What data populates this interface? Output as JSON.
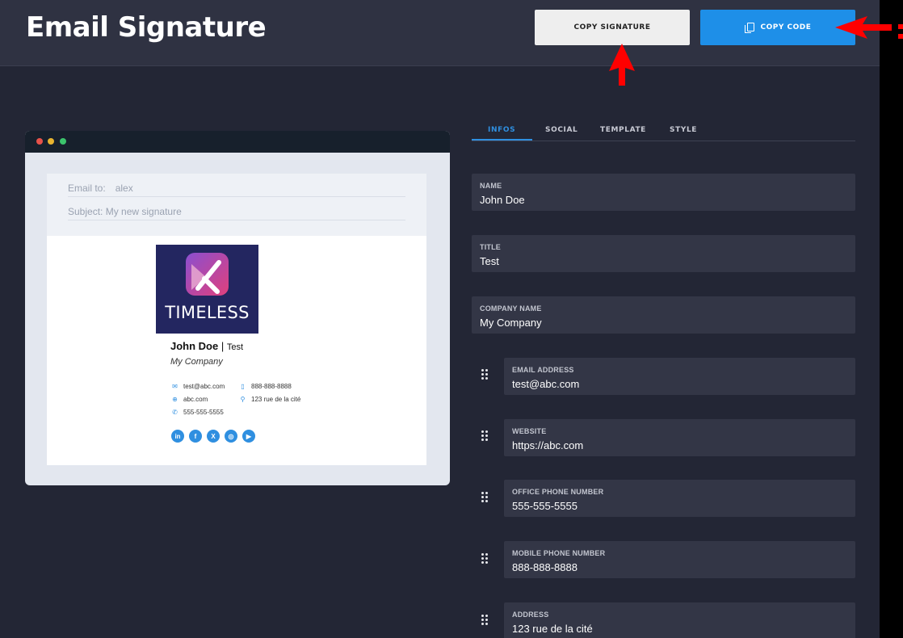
{
  "header": {
    "title": "Email Signature",
    "copy_signature_label": "COPY SIGNATURE",
    "copy_code_label": "COPY CODE"
  },
  "preview": {
    "email_to_label": "Email to:",
    "email_to_value": "alex",
    "subject_label": "Subject:",
    "subject_value": "My new signature",
    "logo_text": "TIMELESS",
    "name": "John Doe",
    "separator": "|",
    "title": "Test",
    "company": "My Company",
    "email": "test@abc.com",
    "website": "abc.com",
    "office_phone": "555-555-5555",
    "mobile_phone": "888-888-8888",
    "address": "123 rue de la cité",
    "socials": [
      {
        "name": "linkedin-icon",
        "glyph": "in"
      },
      {
        "name": "facebook-icon",
        "glyph": "f"
      },
      {
        "name": "x-icon",
        "glyph": "X"
      },
      {
        "name": "instagram-icon",
        "glyph": "◎"
      },
      {
        "name": "youtube-icon",
        "glyph": "▶"
      }
    ]
  },
  "tabs": [
    "INFOS",
    "SOCIAL",
    "TEMPLATE",
    "STYLE"
  ],
  "fields": [
    {
      "label": "NAME",
      "value": "John Doe"
    },
    {
      "label": "TITLE",
      "value": "Test"
    },
    {
      "label": "COMPANY NAME",
      "value": "My Company"
    },
    {
      "label": "EMAIL ADDRESS",
      "value": "test@abc.com"
    },
    {
      "label": "WEBSITE",
      "value": "https://abc.com"
    },
    {
      "label": "OFFICE PHONE NUMBER",
      "value": "555-555-5555"
    },
    {
      "label": "MOBILE PHONE NUMBER",
      "value": "888-888-8888"
    },
    {
      "label": "ADDRESS",
      "value": "123 rue de la cité"
    }
  ],
  "colors": {
    "accent": "#1e8fe8",
    "background": "#232635",
    "arrow": "#ff0000"
  }
}
